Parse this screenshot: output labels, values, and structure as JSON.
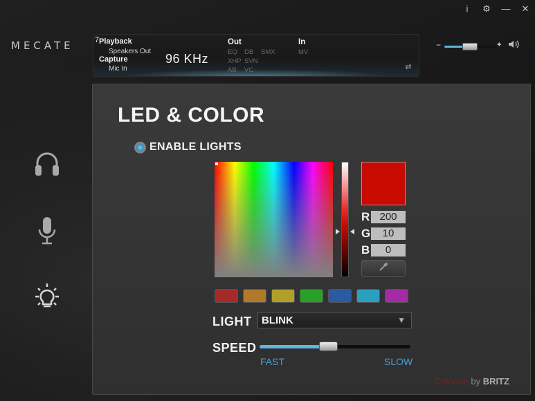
{
  "window": {
    "info_label": "i",
    "settings_label": "⚙",
    "minimize_label": "—",
    "close_label": "✕"
  },
  "app": {
    "logo_text": "MECATE"
  },
  "status": {
    "channels": "7",
    "playback_label": "Playback",
    "playback_device": "Speakers Out",
    "capture_label": "Capture",
    "capture_device": "Mic In",
    "sample_rate": "96  KHz",
    "out_label": "Out",
    "out_effects": [
      "EQ",
      "DB",
      "SMX",
      "XHP",
      "SVN",
      "AB",
      "VC"
    ],
    "in_label": "In",
    "in_effects": [
      "MV"
    ]
  },
  "volume": {
    "minus": "−",
    "plus": "+",
    "level": 0.5
  },
  "nav": {
    "items": [
      {
        "name": "headphones",
        "icon": "headphones-icon"
      },
      {
        "name": "microphone",
        "icon": "microphone-icon"
      },
      {
        "name": "lighting",
        "icon": "lightbulb-icon"
      }
    ]
  },
  "led": {
    "title": "LED & COLOR",
    "enable_label": "ENABLE LIGHTS",
    "color": {
      "r": "200",
      "g": "10",
      "b": "0",
      "hex": "#c80a00"
    },
    "r_label": "R",
    "g_label": "G",
    "b_label": "B",
    "presets": [
      "#a52a2a",
      "#b07a2a",
      "#b0a02a",
      "#2aa02a",
      "#2a5aa0",
      "#2aa0c0",
      "#a52aa5"
    ],
    "light_label": "LIGHT",
    "light_mode": "BLINK",
    "speed_label": "SPEED",
    "speed_value": 0.45,
    "fast_label": "FAST",
    "slow_label": "SLOW"
  },
  "footer": {
    "credit_1": "Coloram",
    "credit_2": "by",
    "credit_3": "BRITZ"
  },
  "colors": {
    "accent": "#5fb6de",
    "link": "#4a9fd0"
  }
}
